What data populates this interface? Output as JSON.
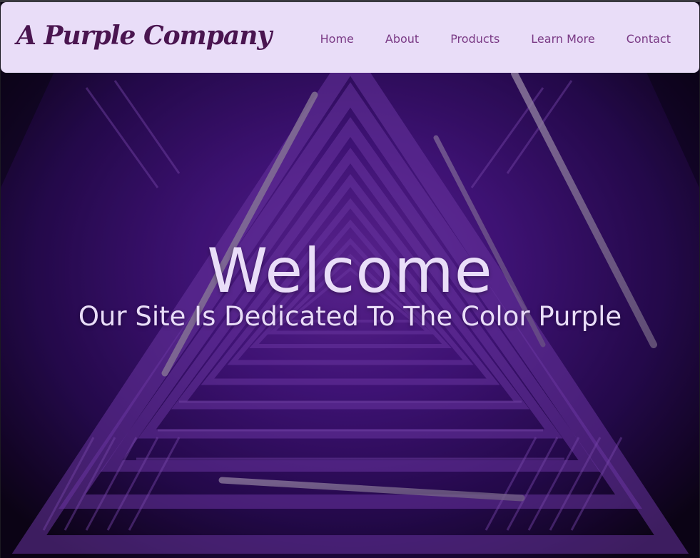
{
  "brand": {
    "name": "A Purple Company"
  },
  "nav": {
    "items": [
      {
        "label": "Home"
      },
      {
        "label": "About"
      },
      {
        "label": "Products"
      },
      {
        "label": "Learn More"
      },
      {
        "label": "Contact"
      }
    ]
  },
  "hero": {
    "heading": "Welcome",
    "subheading": "Our Site Is Dedicated To The Color Purple",
    "background_description_icon": "triangular-stairwell-image"
  },
  "colors": {
    "navbar_bg": "#e9ddf8",
    "brand_text": "#4a1550",
    "nav_link": "#7a3a85",
    "hero_text": "#e9ddf8",
    "hero_bg_dark": "#12061f",
    "hero_purple": "#5b1f9a"
  }
}
